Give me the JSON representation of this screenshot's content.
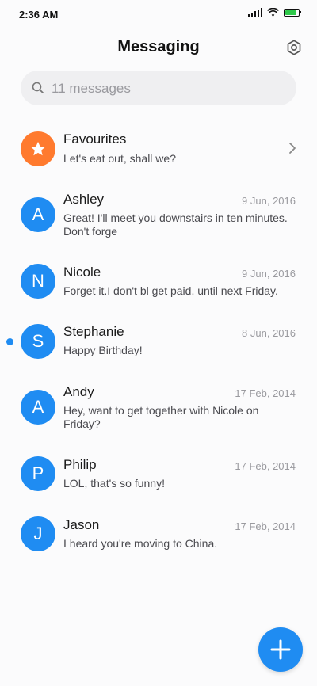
{
  "status_bar": {
    "time": "2:36 AM"
  },
  "header": {
    "title": "Messaging",
    "settings_icon": "gear-icon"
  },
  "search": {
    "placeholder": "11 messages"
  },
  "favourites": {
    "name": "Favourites",
    "preview": "Let's eat out, shall we?",
    "icon": "star-icon"
  },
  "conversations": [
    {
      "initial": "A",
      "name": "Ashley",
      "date": "9 Jun, 2016",
      "preview": "Great! I'll meet you downstairs in ten minutes. Don't forge",
      "unread": false
    },
    {
      "initial": "N",
      "name": "Nicole",
      "date": "9 Jun, 2016",
      "preview": "Forget it.I don't bl get paid. until next Friday.",
      "unread": false
    },
    {
      "initial": "S",
      "name": "Stephanie",
      "date": "8 Jun, 2016",
      "preview": "Happy Birthday!",
      "unread": true
    },
    {
      "initial": "A",
      "name": "Andy",
      "date": "17 Feb, 2014",
      "preview": "Hey, want to get together with Nicole on Friday?",
      "unread": false
    },
    {
      "initial": "P",
      "name": "Philip",
      "date": "17 Feb, 2014",
      "preview": "LOL, that's so funny!",
      "unread": false
    },
    {
      "initial": "J",
      "name": "Jason",
      "date": "17 Feb, 2014",
      "preview": "I heard you're moving to China.",
      "unread": false
    }
  ],
  "fab": {
    "icon": "plus-icon"
  },
  "colors": {
    "accent": "#1f8cf2",
    "favourite": "#ff7a2e",
    "battery": "#2ec84a"
  }
}
